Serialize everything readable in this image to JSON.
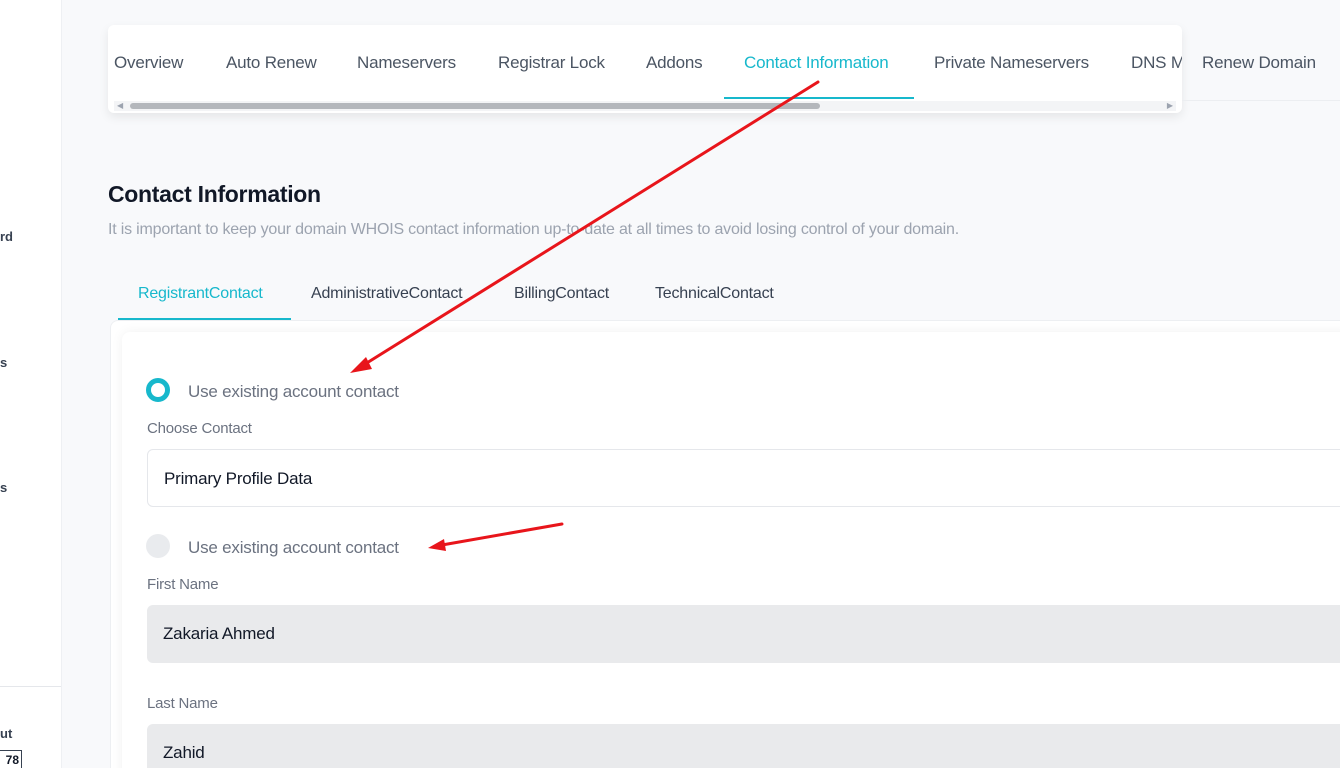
{
  "sidebar": {
    "fragments": [
      "rd",
      "s",
      "s",
      "ut"
    ],
    "badge": "78"
  },
  "top_tabs": [
    {
      "label": "Overview",
      "active": false
    },
    {
      "label": "Auto Renew",
      "active": false
    },
    {
      "label": "Nameservers",
      "active": false
    },
    {
      "label": "Registrar Lock",
      "active": false
    },
    {
      "label": "Addons",
      "active": false
    },
    {
      "label": "Contact Information",
      "active": true
    },
    {
      "label": "Private Nameservers",
      "active": false
    },
    {
      "label": "DNS M",
      "active": false
    }
  ],
  "renew_tab": "Renew Domain",
  "section": {
    "title": "Contact Information",
    "description": "It is important to keep your domain WHOIS contact information up-to-date at all times to avoid losing control of your domain."
  },
  "contact_tabs": [
    {
      "label": "RegistrantContact",
      "active": true
    },
    {
      "label": "AdministrativeContact",
      "active": false
    },
    {
      "label": "BillingContact",
      "active": false
    },
    {
      "label": "TechnicalContact",
      "active": false
    }
  ],
  "form": {
    "option_existing": {
      "label": "Use existing account contact",
      "checked": true
    },
    "choose_contact_label": "Choose Contact",
    "choose_contact_value": "Primary Profile Data",
    "option_custom": {
      "label": "Use existing account contact",
      "checked": false
    },
    "first_name_label": "First Name",
    "first_name_value": "Zakaria Ahmed",
    "last_name_label": "Last Name",
    "last_name_value": "Zahid"
  },
  "colors": {
    "accent": "#17b8cc",
    "annotation_arrow": "#e8151b"
  }
}
